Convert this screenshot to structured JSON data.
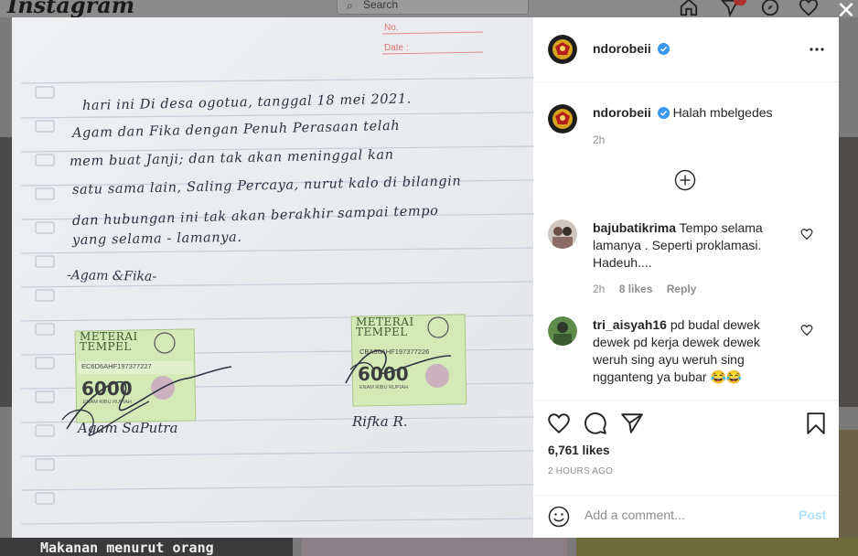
{
  "background": {
    "logo": "Instagram",
    "search_placeholder": "Search",
    "caption": "Makanan menurut orang"
  },
  "post_image": {
    "form_no": "No.",
    "form_date": "Date :",
    "letter_lines": [
      "hari ini Di desa ogotua, tanggal 18 mei 2021.",
      "Agam dan Fika dengan Penuh Perasaan telah",
      "mem buat Janji; dan tak akan meninggal kan",
      "satu sama lain, Saling Percaya, nurut kalo di bilangin",
      "dan hubungan ini tak akan berakhir sampai tempo",
      "yang selama - lamanya."
    ],
    "sign_line": "-Agam &Fika-",
    "stamp_left": {
      "title": "METERAI TEMPEL",
      "code": "EC6D6AHF197377227",
      "value": "6000",
      "words": "ENAM RIBU RUPIAH"
    },
    "stamp_right": {
      "title": "METERAI TEMPEL",
      "code": "CBA36AHF197377226",
      "value": "6000",
      "words": "ENAM RIBU RUPIAH"
    },
    "name_left": "Agam SaPutra",
    "name_right": "Rifka R."
  },
  "post": {
    "author": "ndorobeii",
    "caption": "Halah mbelgedes",
    "caption_time": "2h",
    "comments": [
      {
        "user": "bajubatikrima",
        "text": "Tempo selama lamanya . Seperti proklamasi. Hadeuh....",
        "time": "2h",
        "likes": "8 likes",
        "reply": "Reply"
      },
      {
        "user": "tri_aisyah16",
        "text": "pd budal dewek dewek pd kerja dewek dewek weruh sing ayu weruh sing ngganteng ya bubar 😂😂"
      }
    ],
    "likes": "6,761 likes",
    "time_ago": "2 HOURS AGO",
    "comment_placeholder": "Add a comment...",
    "post_label": "Post"
  },
  "colors": {
    "verified": "#3897f0",
    "post_button": "#b2dffc",
    "ink": "#2c3140",
    "stamp_green": "#cfe8b0"
  }
}
